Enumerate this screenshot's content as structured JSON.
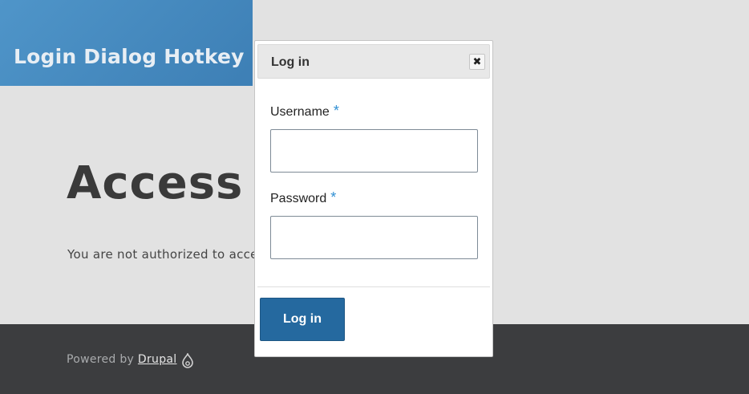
{
  "site": {
    "name": "Login Dialog Hotkey"
  },
  "main": {
    "title": "Access d",
    "message": "You are not authorized to acce"
  },
  "footer": {
    "powered_by": "Powered by ",
    "drupal_link": "Drupal"
  },
  "dialog": {
    "title": "Log in",
    "close_glyph": "✖",
    "username_label": "Username",
    "password_label": "Password",
    "required_mark": "*",
    "username_value": "",
    "password_value": "",
    "submit_label": "Log in"
  },
  "colors": {
    "brand_blue": "#3d7fb5",
    "button_blue": "#25699f",
    "required_star": "#2f8fd3",
    "footer_bg": "#3c3d3f"
  }
}
